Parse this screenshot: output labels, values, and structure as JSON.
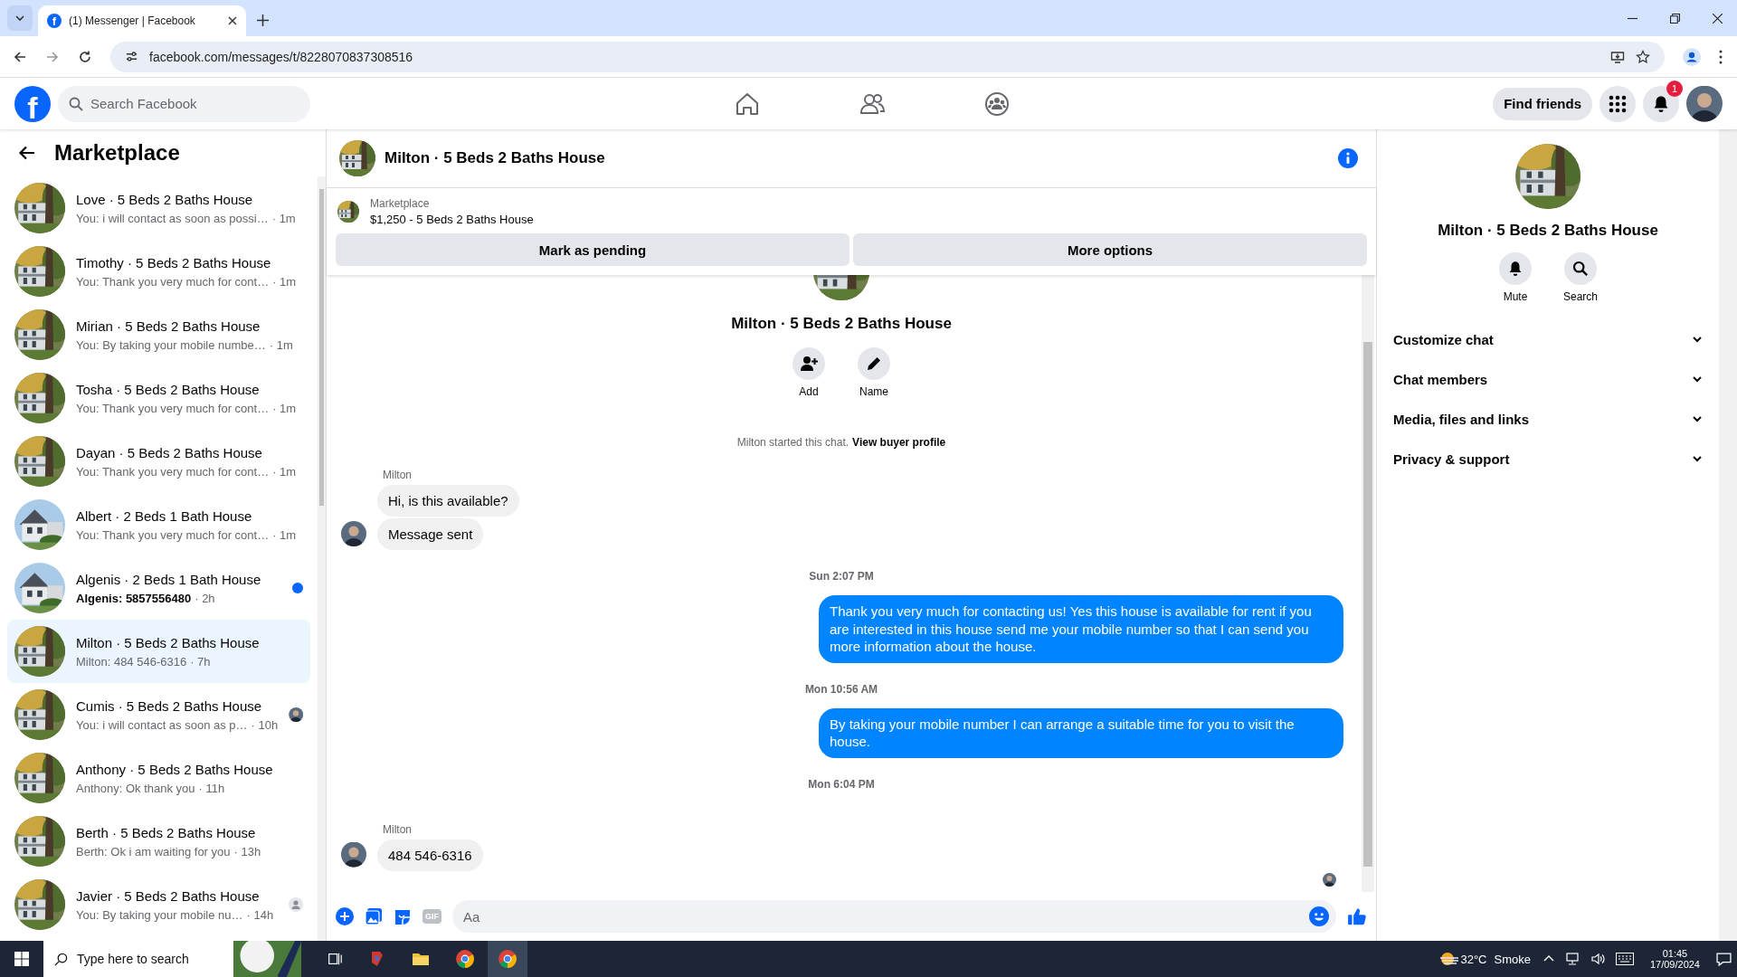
{
  "browser": {
    "tab_title": "(1) Messenger | Facebook",
    "favicon": "f",
    "url": "facebook.com/messages/t/8228070837308516"
  },
  "header": {
    "logo": "f",
    "search_placeholder": "Search Facebook",
    "find_friends": "Find friends",
    "notification_count": "1"
  },
  "sidebar": {
    "title": "Marketplace",
    "conversations": [
      {
        "title": "Love · 5 Beds 2 Baths House",
        "preview": "You: i will contact as soon as possi…",
        "time": "· 1m",
        "unread": false,
        "selected": false
      },
      {
        "title": "Timothy · 5 Beds 2 Baths House",
        "preview": "You: Thank you very much for cont…",
        "time": "· 1m",
        "unread": false,
        "selected": false
      },
      {
        "title": "Mirian · 5 Beds 2 Baths House",
        "preview": "You: By taking your mobile numbe…",
        "time": "· 1m",
        "unread": false,
        "selected": false
      },
      {
        "title": "Tosha · 5 Beds 2 Baths House",
        "preview": "You: Thank you very much for cont…",
        "time": "· 1m",
        "unread": false,
        "selected": false
      },
      {
        "title": "Dayan · 5 Beds 2 Baths House",
        "preview": "You: Thank you very much for cont…",
        "time": "· 1m",
        "unread": false,
        "selected": false
      },
      {
        "title": "Albert · 2 Beds 1 Bath House",
        "preview": "You: Thank you very much for cont…",
        "time": "· 1m",
        "unread": false,
        "selected": false
      },
      {
        "title": "Algenis · 2 Beds 1 Bath House",
        "preview": "Algenis: 5857556480",
        "time": "· 2h",
        "unread": true,
        "selected": false
      },
      {
        "title": "Milton · 5 Beds 2 Baths House",
        "preview": "Milton: 484 546-6316",
        "time": "· 7h",
        "unread": false,
        "selected": true
      },
      {
        "title": "Cumis · 5 Beds 2 Baths House",
        "preview": "You: i will contact as soon as p…",
        "time": "· 10h",
        "unread": false,
        "selected": false,
        "receipt": {
          "kind": "avatar"
        }
      },
      {
        "title": "Anthony · 5 Beds 2 Baths House",
        "preview": "Anthony: Ok thank you",
        "time": "· 11h",
        "unread": false,
        "selected": false
      },
      {
        "title": "Berth · 5 Beds 2 Baths House",
        "preview": "Berth: Ok i am waiting for you",
        "time": "· 13h",
        "unread": false,
        "selected": false
      },
      {
        "title": "Javier · 5 Beds 2 Baths House",
        "preview": "You: By taking your mobile nu…",
        "time": "· 14h",
        "unread": false,
        "selected": false,
        "receipt": {
          "kind": "person"
        }
      }
    ]
  },
  "chat": {
    "title": "Milton · 5 Beds 2 Baths House",
    "listing": {
      "label": "Marketplace",
      "detail": "$1,250 - 5 Beds 2 Baths House"
    },
    "buttons": [
      "Mark as pending",
      "More options"
    ],
    "intro": {
      "title": "Milton · 5 Beds 2 Baths House",
      "actions": [
        {
          "kind": "add",
          "label": "Add"
        },
        {
          "kind": "name",
          "label": "Name"
        }
      ],
      "started": "Milton started this chat.",
      "link": "View buyer profile"
    },
    "messages": [
      {
        "kind": "incoming",
        "sender": "Milton",
        "bubbles": [
          "Hi, is this available?",
          "Message sent"
        ]
      },
      {
        "kind": "timestamp",
        "text": "Sun 2:07 PM"
      },
      {
        "kind": "outgoing",
        "text": "Thank you very much for contacting us! Yes this house is available for rent if you are interested in this house send me your mobile number so that I can send you more information about the house."
      },
      {
        "kind": "timestamp",
        "text": "Mon 10:56 AM"
      },
      {
        "kind": "outgoing",
        "text": "By taking your mobile number I can arrange a suitable time for you to visit the house."
      },
      {
        "kind": "timestamp",
        "text": "Mon 6:04 PM"
      },
      {
        "kind": "incoming",
        "sender": "Milton",
        "bubbles": [
          "484 546-6316"
        ]
      }
    ],
    "composer": {
      "gif": "GIF",
      "placeholder": "Aa"
    }
  },
  "details": {
    "title": "Milton · 5 Beds 2 Baths House",
    "actions": [
      {
        "kind": "mute",
        "label": "Mute"
      },
      {
        "kind": "search",
        "label": "Search"
      }
    ],
    "sections": [
      "Customize chat",
      "Chat members",
      "Media, files and links",
      "Privacy & support"
    ]
  },
  "taskbar": {
    "search_placeholder": "Type here to search",
    "temperature": "32°C",
    "weather": "Smoke",
    "time": "01:45",
    "date": "17/09/2024"
  }
}
